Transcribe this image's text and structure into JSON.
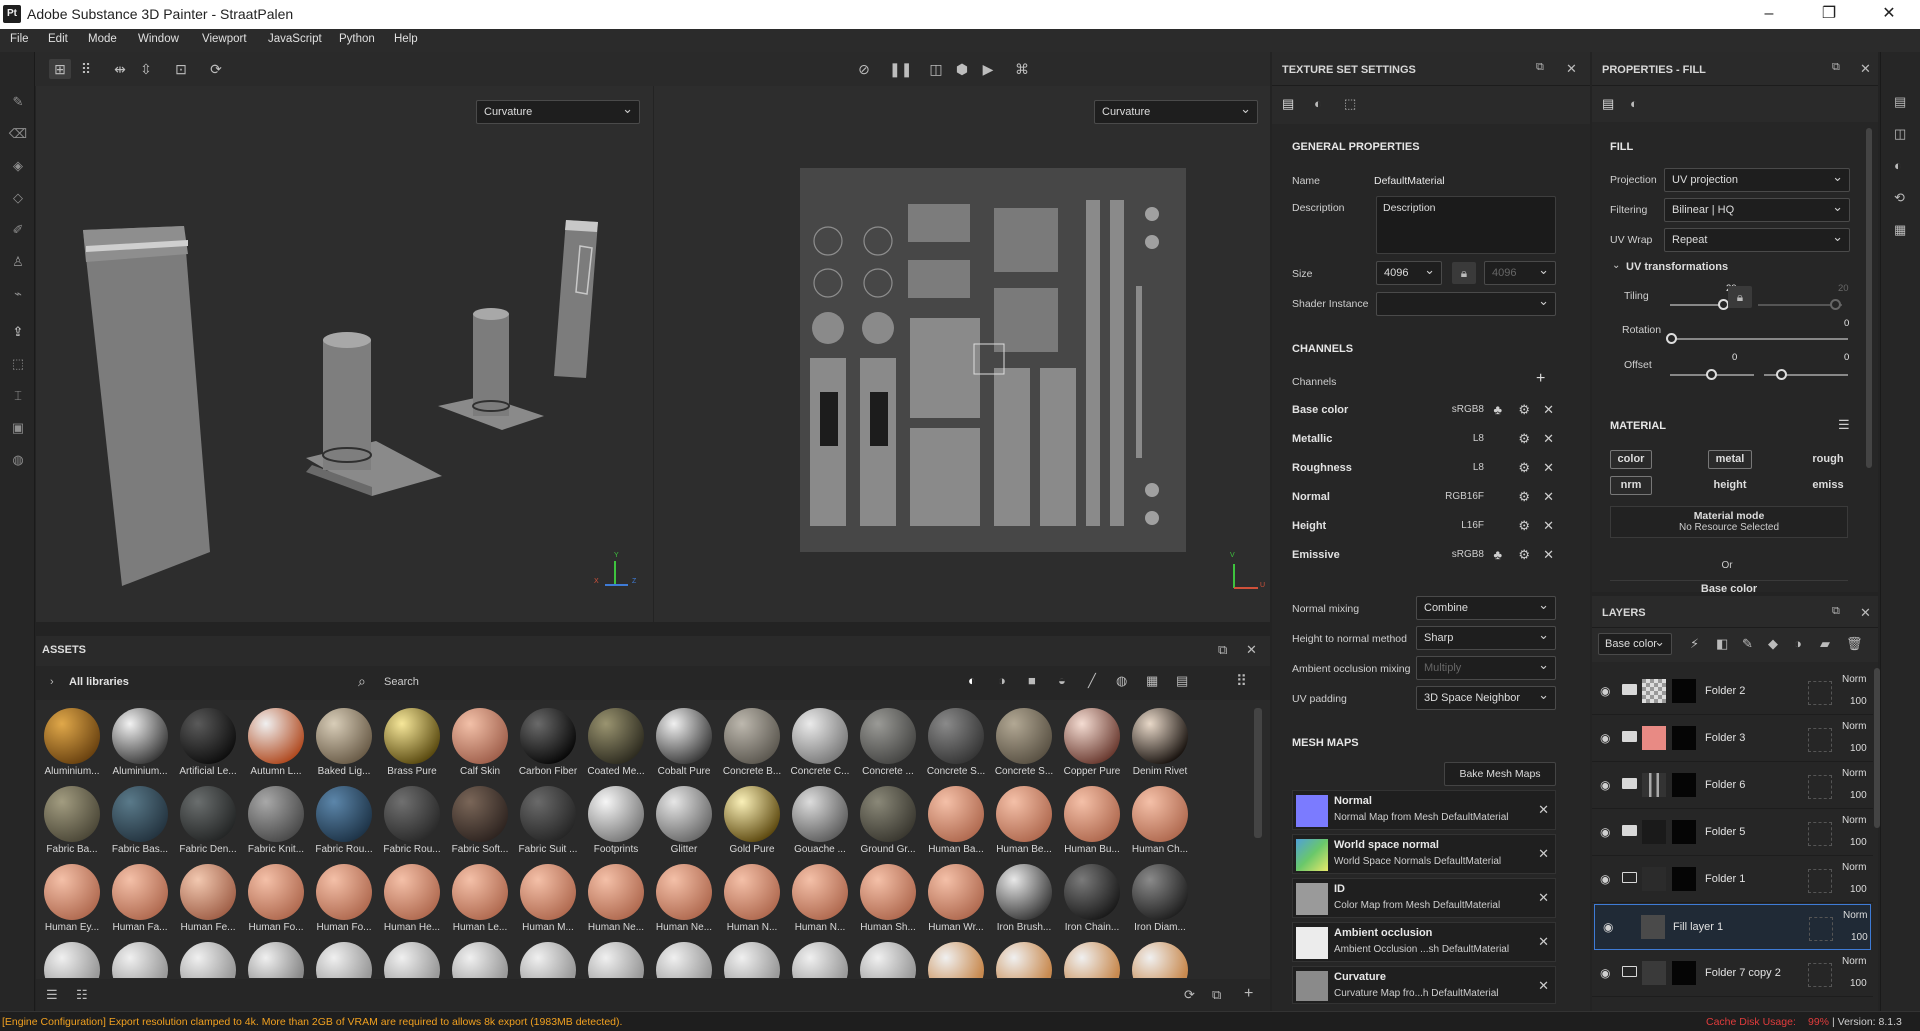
{
  "window": {
    "title": "Adobe Substance 3D Painter - StraatPalen",
    "logo": "Pt",
    "min": "–",
    "max": "❐",
    "close": "✕"
  },
  "menu": [
    "File",
    "Edit",
    "Mode",
    "Window",
    "Viewport",
    "JavaScript",
    "Python",
    "Help"
  ],
  "viewport": {
    "left_channel": "Curvature",
    "right_channel": "Curvature",
    "axis_y": "Y",
    "axis_z": "Z",
    "axis_x": "X",
    "axis_v": "V",
    "axis_u": "U"
  },
  "texture_set": {
    "title": "TEXTURE SET SETTINGS",
    "general_header": "GENERAL PROPERTIES",
    "name_label": "Name",
    "name_value": "DefaultMaterial",
    "description_label": "Description",
    "description_value": "Description",
    "size_label": "Size",
    "size_value": "4096",
    "size_value_locked": "4096",
    "shader_label": "Shader Instance",
    "channels_header": "CHANNELS",
    "channels_label": "Channels",
    "channels": [
      {
        "name": "Base color",
        "format": "sRGB8"
      },
      {
        "name": "Metallic",
        "format": "L8"
      },
      {
        "name": "Roughness",
        "format": "L8"
      },
      {
        "name": "Normal",
        "format": "RGB16F"
      },
      {
        "name": "Height",
        "format": "L16F"
      },
      {
        "name": "Emissive",
        "format": "sRGB8"
      }
    ],
    "normal_mixing_label": "Normal mixing",
    "normal_mixing_value": "Combine",
    "height_normal_label": "Height to normal method",
    "height_normal_value": "Sharp",
    "ao_mixing_label": "Ambient occlusion mixing",
    "ao_mixing_value": "Multiply",
    "uv_padding_label": "UV padding",
    "uv_padding_value": "3D Space Neighbor",
    "mesh_maps_header": "MESH MAPS",
    "bake_button": "Bake Mesh Maps",
    "mesh_maps": [
      {
        "title": "Normal",
        "sub": "Normal Map from Mesh DefaultMaterial",
        "color": "#7b7bff"
      },
      {
        "title": "World space normal",
        "sub": "World Space Normals DefaultMaterial",
        "color": "#5aa37a"
      },
      {
        "title": "ID",
        "sub": "Color Map from Mesh DefaultMaterial",
        "color": "#9a9a9a"
      },
      {
        "title": "Ambient occlusion",
        "sub": "Ambient Occlusion ...sh DefaultMaterial",
        "color": "#e8e8e8"
      },
      {
        "title": "Curvature",
        "sub": "Curvature Map fro...h DefaultMaterial",
        "color": "#8a8a8a"
      }
    ]
  },
  "properties": {
    "title": "PROPERTIES - FILL",
    "fill_header": "FILL",
    "projection_label": "Projection",
    "projection_value": "UV projection",
    "filtering_label": "Filtering",
    "filtering_value": "Bilinear | HQ",
    "uvwrap_label": "UV Wrap",
    "uvwrap_value": "Repeat",
    "uvtrans_header": "UV transformations",
    "tiling_label": "Tiling",
    "tiling_value": "20",
    "tiling_value2": "20",
    "rotation_label": "Rotation",
    "rotation_value": "0",
    "offset_label": "Offset",
    "offset_value": "0",
    "offset_value2": "0",
    "material_header": "MATERIAL",
    "tags": [
      "color",
      "metal",
      "rough",
      "nrm",
      "height",
      "emiss"
    ],
    "material_mode_title": "Material mode",
    "material_mode_sub": "No Resource Selected",
    "or_label": "Or",
    "base_color_label": "Base color"
  },
  "layers": {
    "title": "LAYERS",
    "channel_select": "Base color",
    "items": [
      {
        "name": "Folder 2",
        "blend": "Norm",
        "opacity": "100",
        "thumb": "checker"
      },
      {
        "name": "Folder 3",
        "blend": "Norm",
        "opacity": "100",
        "thumb": "#e88a84"
      },
      {
        "name": "Folder 6",
        "blend": "Norm",
        "opacity": "100",
        "thumb": "#333"
      },
      {
        "name": "Folder 5",
        "blend": "Norm",
        "opacity": "100",
        "thumb": "#1a1a1a"
      },
      {
        "name": "Folder 1",
        "blend": "Norm",
        "opacity": "100",
        "thumb": "#2b2b2b"
      },
      {
        "name": "Fill layer 1",
        "blend": "Norm",
        "opacity": "100",
        "thumb": "#4a4a4a"
      },
      {
        "name": "Folder 7 copy 2",
        "blend": "Norm",
        "opacity": "100",
        "thumb": "#3a3a3a"
      }
    ]
  },
  "assets": {
    "title": "ASSETS",
    "libraries": "All libraries",
    "search_placeholder": "Search",
    "materials": [
      {
        "name": "Aluminium...",
        "c1": "#e0a84a",
        "c2": "#6a4210"
      },
      {
        "name": "Aluminium...",
        "c1": "#f2f2f2",
        "c2": "#3a3a3a"
      },
      {
        "name": "Artificial Le...",
        "c1": "#5a5a5a",
        "c2": "#0e0e0e"
      },
      {
        "name": "Autumn L...",
        "c1": "#f0f0f0",
        "c2": "#b04a20"
      },
      {
        "name": "Baked Lig...",
        "c1": "#d8cdb8",
        "c2": "#6a5c48"
      },
      {
        "name": "Brass Pure",
        "c1": "#f6e79a",
        "c2": "#5a4a10"
      },
      {
        "name": "Calf Skin",
        "c1": "#f2c0a8",
        "c2": "#a0604c"
      },
      {
        "name": "Carbon Fiber",
        "c1": "#6a6a6a",
        "c2": "#080808"
      },
      {
        "name": "Coated Me...",
        "c1": "#9a9470",
        "c2": "#2e2c20"
      },
      {
        "name": "Cobalt Pure",
        "c1": "#f0f0f0",
        "c2": "#3a3a3a"
      },
      {
        "name": "Concrete B...",
        "c1": "#bdb8ae",
        "c2": "#5c5850"
      },
      {
        "name": "Concrete C...",
        "c1": "#eaeaea",
        "c2": "#7a7a7a"
      },
      {
        "name": "Concrete ...",
        "c1": "#9a9a96",
        "c2": "#464644"
      },
      {
        "name": "Concrete S...",
        "c1": "#8a8a8a",
        "c2": "#363636"
      },
      {
        "name": "Concrete S...",
        "c1": "#b2a894",
        "c2": "#5a5244"
      },
      {
        "name": "Copper Pure",
        "c1": "#f4dcd2",
        "c2": "#6a3a30"
      },
      {
        "name": "Denim Rivet",
        "c1": "#e8d8c8",
        "c2": "#1a1410"
      },
      {
        "name": "Fabric Ba...",
        "c1": "#a29c80",
        "c2": "#4c4838"
      },
      {
        "name": "Fabric Bas...",
        "c1": "#5a7a8a",
        "c2": "#243440"
      },
      {
        "name": "Fabric Den...",
        "c1": "#6a6e6e",
        "c2": "#242626"
      },
      {
        "name": "Fabric Knit...",
        "c1": "#a8a8a8",
        "c2": "#4a4a4a"
      },
      {
        "name": "Fabric Rou...",
        "c1": "#5c86aa",
        "c2": "#1e3448"
      },
      {
        "name": "Fabric Rou...",
        "c1": "#707070",
        "c2": "#2a2a2a"
      },
      {
        "name": "Fabric Soft...",
        "c1": "#7a6658",
        "c2": "#2e2420"
      },
      {
        "name": "Fabric Suit ...",
        "c1": "#6a6a6a",
        "c2": "#262626"
      },
      {
        "name": "Footprints",
        "c1": "#f6f6f6",
        "c2": "#7a7a7a"
      },
      {
        "name": "Glitter",
        "c1": "#e6e6e6",
        "c2": "#6a6a6a"
      },
      {
        "name": "Gold Pure",
        "c1": "#faf0b8",
        "c2": "#5e4a10"
      },
      {
        "name": "Gouache ...",
        "c1": "#dcdcdc",
        "c2": "#5e5e5e"
      },
      {
        "name": "Ground Gr...",
        "c1": "#8a8878",
        "c2": "#3a3830"
      },
      {
        "name": "Human Ba...",
        "c1": "#f4c0a8",
        "c2": "#b06a50"
      },
      {
        "name": "Human Be...",
        "c1": "#f4c0a8",
        "c2": "#b06a50"
      },
      {
        "name": "Human Bu...",
        "c1": "#f4c0a8",
        "c2": "#b06a50"
      },
      {
        "name": "Human Ch...",
        "c1": "#f4c0a8",
        "c2": "#b06a50"
      },
      {
        "name": "Human Ey...",
        "c1": "#f4c0a8",
        "c2": "#b06a50"
      },
      {
        "name": "Human Fa...",
        "c1": "#f4c0a8",
        "c2": "#b06a50"
      },
      {
        "name": "Human Fe...",
        "c1": "#f2c8b0",
        "c2": "#a06048"
      },
      {
        "name": "Human Fo...",
        "c1": "#f4c0a8",
        "c2": "#b06a50"
      },
      {
        "name": "Human Fo...",
        "c1": "#f4c0a8",
        "c2": "#b06a50"
      },
      {
        "name": "Human He...",
        "c1": "#f4c0a8",
        "c2": "#b06a50"
      },
      {
        "name": "Human Le...",
        "c1": "#f4c0a8",
        "c2": "#b06a50"
      },
      {
        "name": "Human M...",
        "c1": "#f4c0a8",
        "c2": "#b06a50"
      },
      {
        "name": "Human Ne...",
        "c1": "#f4c0a8",
        "c2": "#b06a50"
      },
      {
        "name": "Human Ne...",
        "c1": "#f4c0a8",
        "c2": "#b06a50"
      },
      {
        "name": "Human N...",
        "c1": "#f4c0a8",
        "c2": "#b06a50"
      },
      {
        "name": "Human N...",
        "c1": "#f4c0a8",
        "c2": "#b06a50"
      },
      {
        "name": "Human Sh...",
        "c1": "#f4c0a8",
        "c2": "#b06a50"
      },
      {
        "name": "Human Wr...",
        "c1": "#f4c0a8",
        "c2": "#b06a50"
      },
      {
        "name": "Iron Brush...",
        "c1": "#e8e8e8",
        "c2": "#3a3a3a"
      },
      {
        "name": "Iron Chain...",
        "c1": "#7a7a7a",
        "c2": "#1a1a1a"
      },
      {
        "name": "Iron Diam...",
        "c1": "#8a8a8a",
        "c2": "#202020"
      }
    ]
  },
  "status": {
    "message": "[Engine Configuration] Export resolution clamped to 4k. More than 2GB of VRAM are required to allows 8k export (1983MB detected).",
    "cache_label": "Cache Disk Usage:",
    "cache_value": "99%",
    "version": "| Version: 8.1.3"
  },
  "colors": {
    "accent": "#3e7bd6",
    "status_text": "#f0a020",
    "cache_red": "#e03c3c"
  }
}
